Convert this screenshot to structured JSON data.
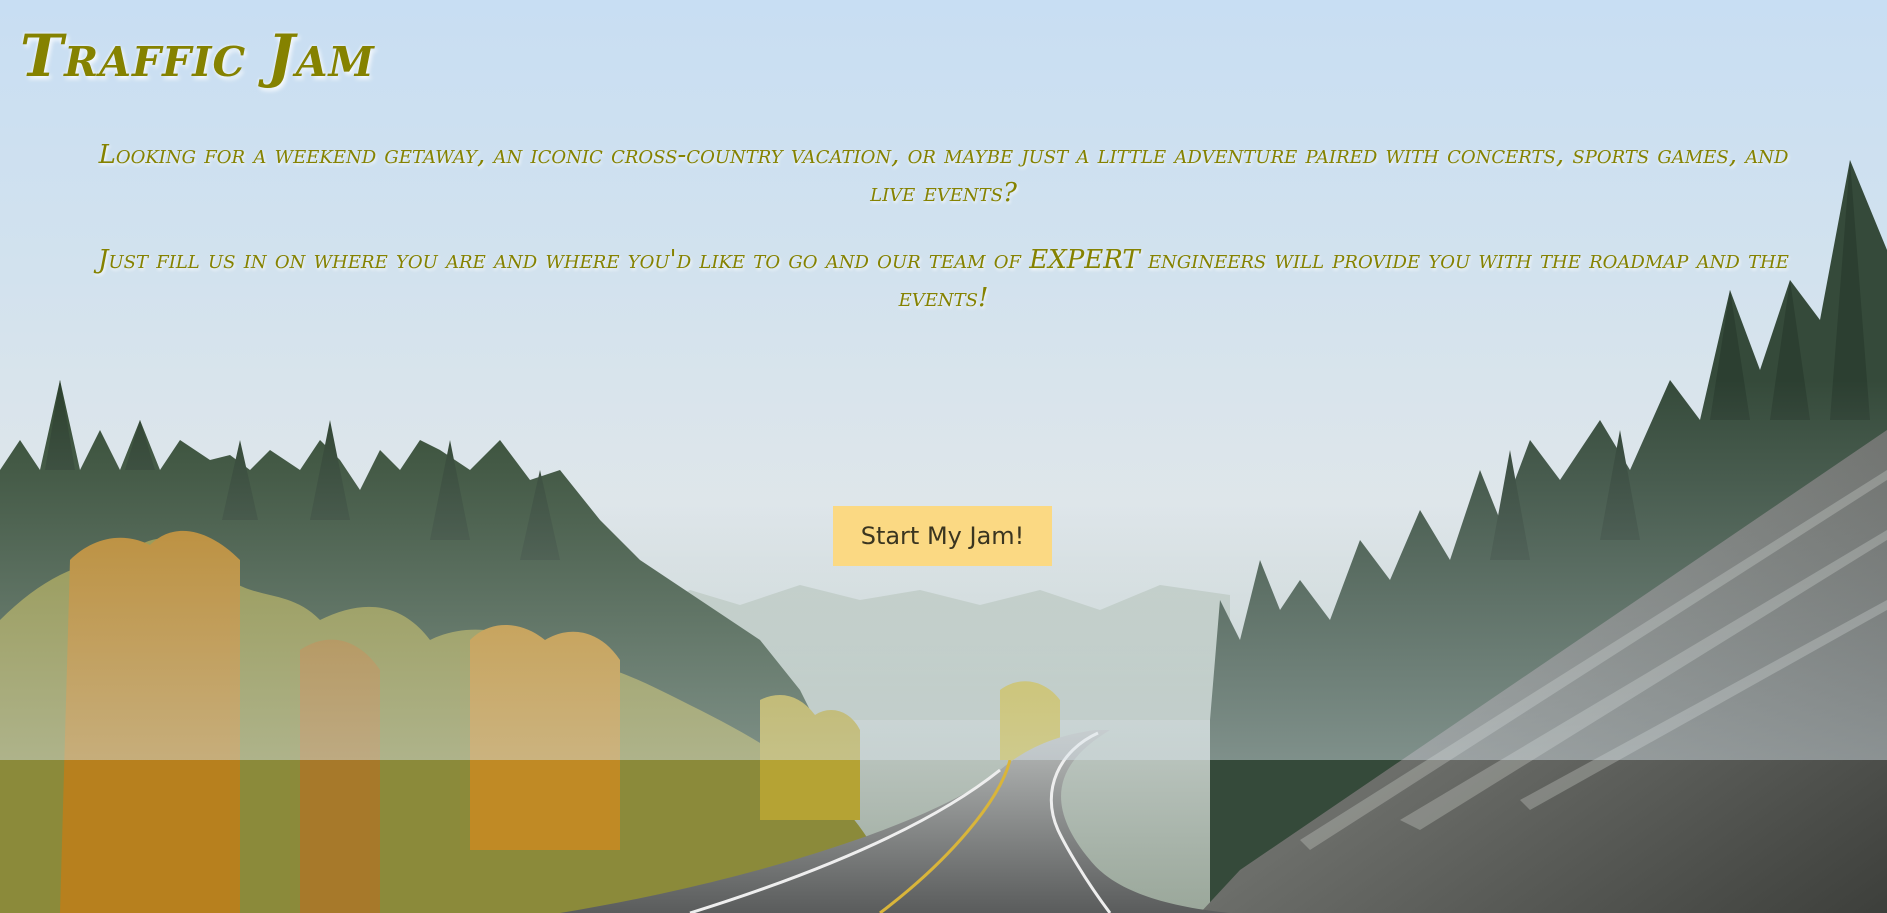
{
  "site": {
    "title": "Traffic Jam"
  },
  "intro": {
    "paragraph_1": "Looking for a weekend getaway, an iconic cross-country vacation, or maybe just a little adventure paired with concerts, sports games, and live events?",
    "paragraph_2": "Just fill us in on where you are and where you'd like to go and our team of EXPERT engineers will provide you with the roadmap and the events!"
  },
  "cta": {
    "label": "Start My Jam!"
  },
  "colors": {
    "title_text": "#858200",
    "button_bg": "#fbd983",
    "button_text": "#3a3520"
  },
  "background": {
    "icon": "forest-road-photo"
  }
}
